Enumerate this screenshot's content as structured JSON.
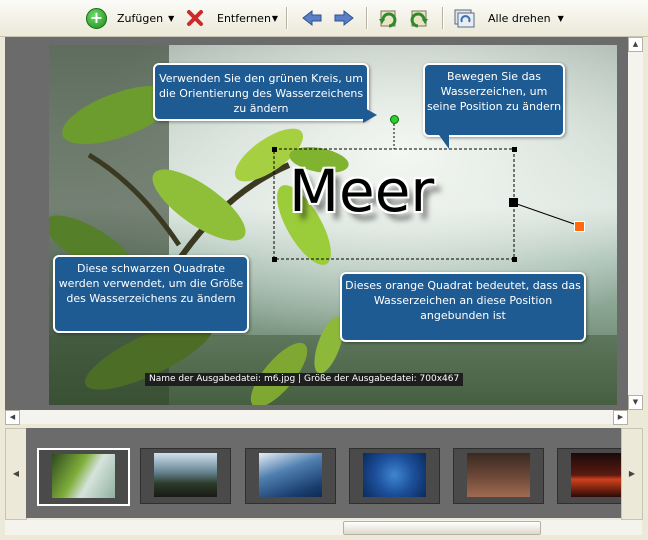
{
  "toolbar": {
    "add_label": "Zufügen",
    "remove_label": "Entfernen",
    "rotate_all_label": "Alle drehen"
  },
  "watermark": {
    "text": "Meer"
  },
  "callouts": {
    "green_circle": "Verwenden Sie den grünen Kreis, um die Orientierung des Wasserzeichens zu ändern",
    "move": "Bewegen Sie das Wasserzeichen, um seine Position zu ändern",
    "black_squares": "Diese schwarzen Quadrate werden verwendet, um die Größe des Wasserzeichens zu ändern",
    "orange_square": "Dieses orange  Quadrat bedeutet, dass das Wasserzeichen an diese Position angebunden ist"
  },
  "caption": "Name der Ausgabedatei: m6.jpg | Größe der Ausgabedatei: 700x467",
  "colors": {
    "callout_bg": "#1f5b93",
    "anchor": "#ff6a10",
    "rotate_handle": "#2bd02b",
    "add_button": "#2a9a26",
    "remove_icon": "#cc2a2a"
  },
  "icons": [
    "add-icon",
    "remove-icon",
    "arrow-left-icon",
    "arrow-right-icon",
    "rotate-left-icon",
    "rotate-right-icon",
    "rotate-all-icon"
  ]
}
